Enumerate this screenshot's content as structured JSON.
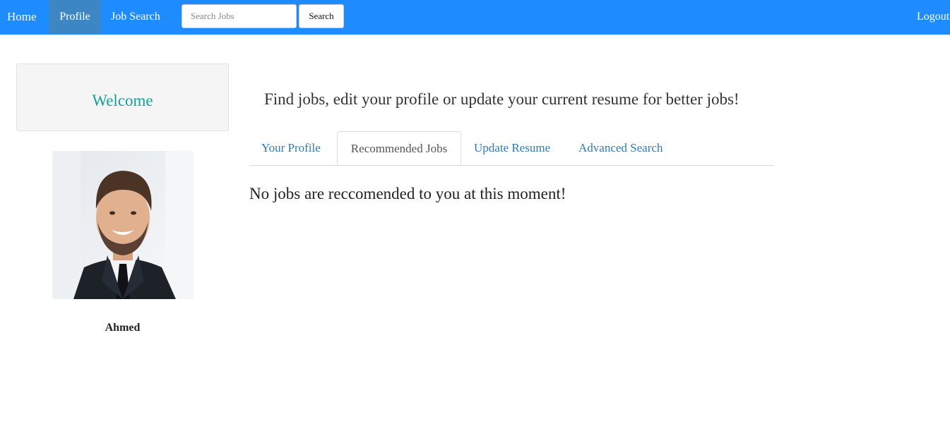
{
  "navbar": {
    "home_label": "Home",
    "profile_label": "Profile",
    "job_search_label": "Job Search",
    "search_placeholder": "Search Jobs",
    "search_value": "",
    "search_button_label": "Search",
    "logout_label": "Logout",
    "background_color": "#1e8cff",
    "active_item_color": "#3c86c4"
  },
  "sidebar": {
    "welcome_text": "Welcome",
    "welcome_color": "#15a09a",
    "avatar_icon": "user-avatar-photo",
    "user_name": "Ahmed"
  },
  "main": {
    "tagline": "Find jobs, edit your profile or update your current resume for better jobs!",
    "tabs": [
      {
        "label": "Your Profile",
        "active": false
      },
      {
        "label": "Recommended Jobs",
        "active": true
      },
      {
        "label": "Update Resume",
        "active": false
      },
      {
        "label": "Advanced Search",
        "active": false
      }
    ],
    "empty_message": "No jobs are reccomended to you at this moment!",
    "link_color": "#2f7ab9"
  }
}
